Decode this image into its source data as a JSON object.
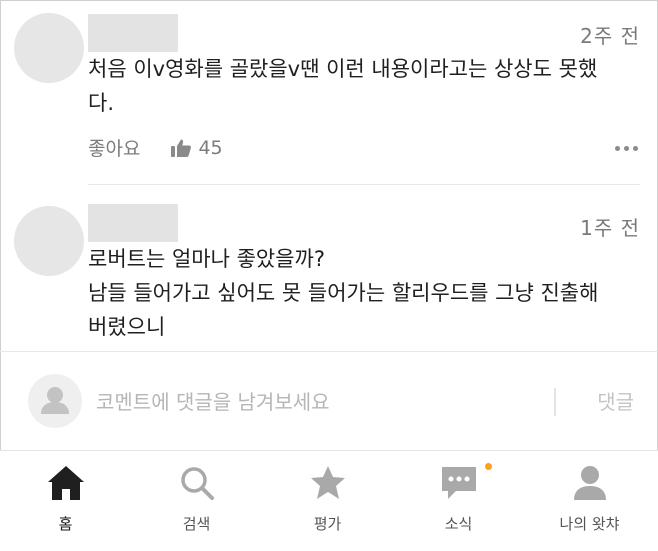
{
  "comments": [
    {
      "time": "2주 전",
      "text": "처음 이v영화를 골랐을v땐 이런 내용이라고는 상상도 못했\n다.",
      "like_label": "좋아요",
      "like_count": "45"
    },
    {
      "time": "1주 전",
      "text": "로버트는 얼마나 좋았을까?\n남들 들어가고 싶어도 못 들어가는 할리우드를 그냥 진출해\n버렸으니"
    }
  ],
  "reply": {
    "placeholder": "코멘트에 댓글을 남겨보세요",
    "submit_label": "댓글"
  },
  "tabs": [
    {
      "label": "홈",
      "icon": "home-icon",
      "active": true
    },
    {
      "label": "검색",
      "icon": "search-icon"
    },
    {
      "label": "평가",
      "icon": "star-icon"
    },
    {
      "label": "소식",
      "icon": "chat-icon",
      "badge": true
    },
    {
      "label": "나의 왓챠",
      "icon": "person-icon"
    }
  ],
  "colors": {
    "badge": "#ff9f1c",
    "muted_text": "#7c7c7c",
    "placeholder": "#b6b6b6"
  }
}
